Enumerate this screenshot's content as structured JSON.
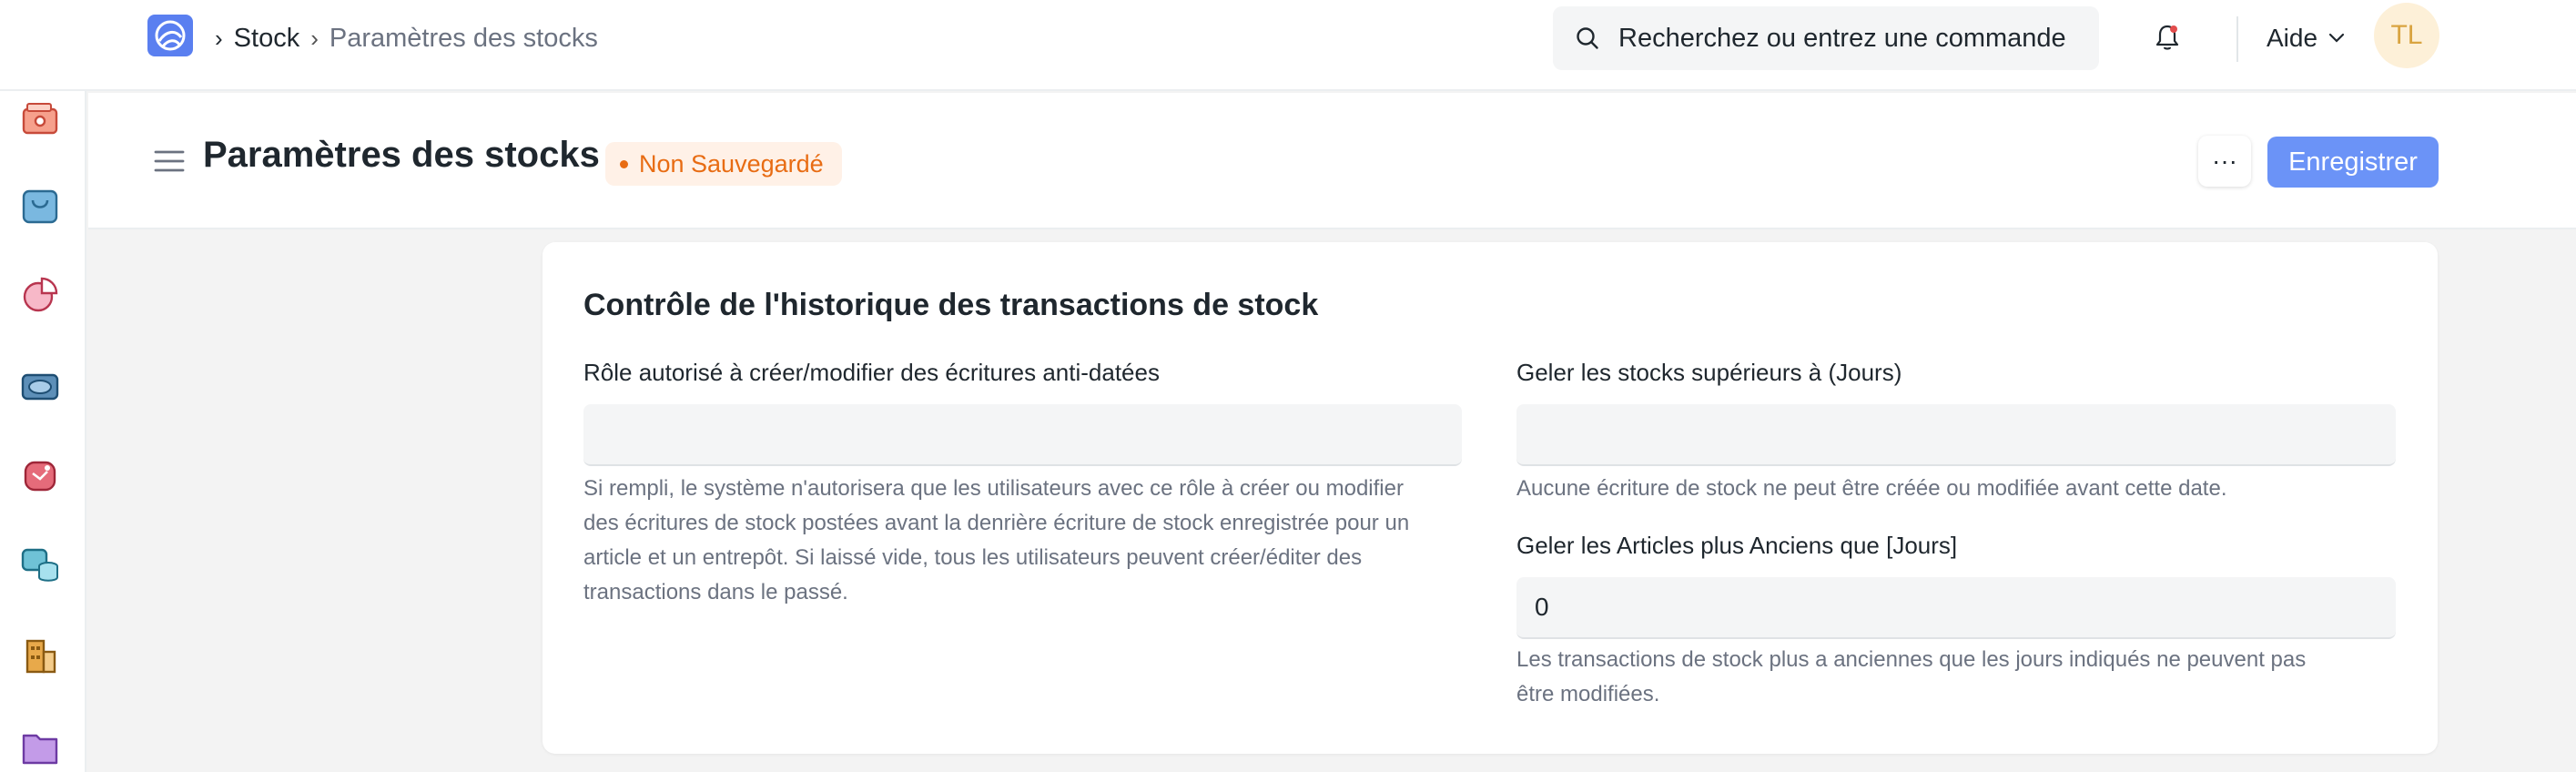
{
  "navbar": {
    "breadcrumb": {
      "separator": "›",
      "parent": "Stock",
      "current": "Paramètres des stocks"
    },
    "search": {
      "placeholder": "Recherchez ou entrez une commande"
    },
    "help_label": "Aide",
    "avatar_initials": "TL"
  },
  "sidebar": {
    "icons": [
      "wallet-icon",
      "shopping-bag-icon",
      "pie-chart-icon",
      "money-icon",
      "support-icon",
      "database-chat-icon",
      "buildings-icon",
      "folder-icon"
    ]
  },
  "page": {
    "title": "Paramètres des stocks",
    "status": "Non Sauvegardé",
    "more_label": "···",
    "save_label": "Enregistrer"
  },
  "section": {
    "title": "Contrôle de l'historique des transactions de stock",
    "fields": {
      "role": {
        "label": "Rôle autorisé à créer/modifier des écritures anti-datées",
        "value": "",
        "description_lines": [
          "Si rempli, le système n'autorisera que les utilisateurs avec ce rôle à créer ou modifier",
          "des écritures de stock postées avant la denrière écriture de stock enregistrée pour un",
          "article et un entrepôt. Si laissé vide, tous les utilisateurs peuvent créer/éditer des",
          "transactions dans le passé."
        ]
      },
      "freeze_stocks": {
        "label": "Geler les stocks supérieurs à (Jours)",
        "value": "",
        "description": "Aucune écriture de stock ne peut être créée ou modifiée avant cette date."
      },
      "freeze_items": {
        "label": "Geler les Articles plus Anciens que [Jours]",
        "value": "0",
        "description_lines": [
          "Les transactions de stock plus a anciennes que les jours indiqués ne peuvent pas",
          "être modifiées."
        ]
      }
    }
  },
  "colors": {
    "accent": "#6b93f7",
    "status_orange": "#e86c13",
    "status_bg": "#fff1e7",
    "avatar_bg": "#fdf0d8"
  }
}
